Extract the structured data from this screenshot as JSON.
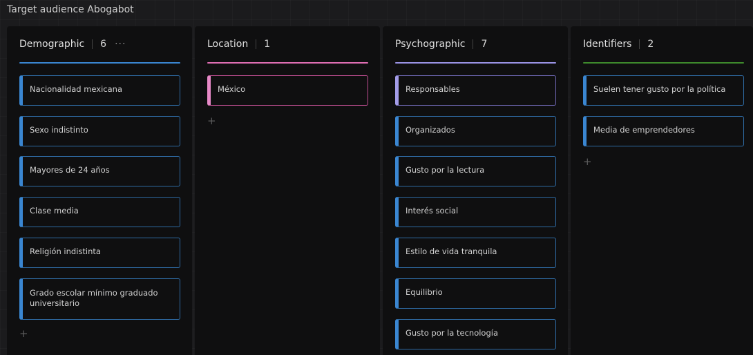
{
  "board": {
    "title": "Target audience Abogabot"
  },
  "columns": [
    {
      "name": "Demographic",
      "count": "6",
      "more": "···",
      "accent": "#3a86d1",
      "cards": [
        "Nacionalidad mexicana",
        "Sexo indistinto",
        "Mayores de 24 años",
        "Clase media",
        "Religión indistinta",
        "Grado escolar mínimo graduado universitario"
      ],
      "add": "+"
    },
    {
      "name": "Location",
      "count": "1",
      "accent": "#e06fb4",
      "cards": [
        "México"
      ],
      "add": "+"
    },
    {
      "name": "Psychographic",
      "count": "7",
      "accent": "#9b94e6",
      "cards": [
        "Responsables",
        "Organizados",
        "Gusto por la lectura",
        "Interés social",
        "Estilo de vida tranquila",
        "Equilibrio",
        "Gusto por la tecnología"
      ]
    },
    {
      "name": "Identifiers",
      "count": "2",
      "accent": "#3e8a2c",
      "cards": [
        "Suelen tener gusto por la política",
        "Media de emprendedores"
      ],
      "add": "+"
    }
  ]
}
